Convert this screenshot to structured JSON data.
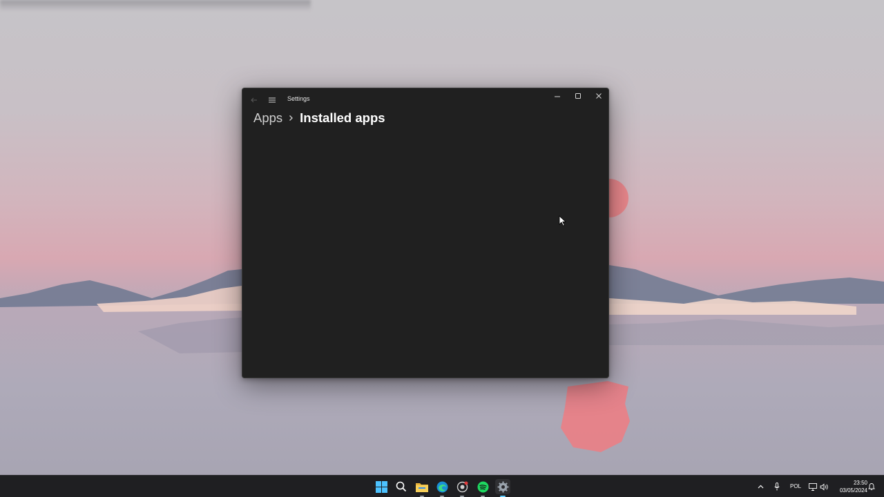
{
  "window": {
    "title": "Settings",
    "breadcrumb": {
      "parent": "Apps",
      "current": "Installed apps"
    }
  },
  "taskbar": {
    "apps": [
      {
        "name": "start-icon"
      },
      {
        "name": "search-icon"
      },
      {
        "name": "file-explorer-icon"
      },
      {
        "name": "edge-icon"
      },
      {
        "name": "github-icon"
      },
      {
        "name": "spotify-icon"
      },
      {
        "name": "settings-icon",
        "active": true
      }
    ],
    "tray": {
      "language": "POL",
      "time": "23:50",
      "date": "03/05/2024"
    }
  },
  "colors": {
    "window_bg": "#202020",
    "taskbar_bg": "#1f1f22",
    "accent": "#60cdff"
  }
}
